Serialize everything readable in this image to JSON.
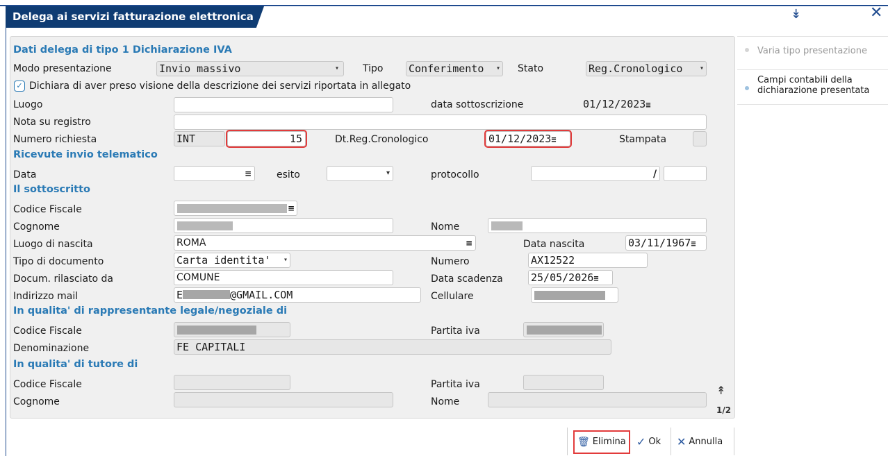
{
  "window": {
    "title": "Delega ai servizi fatturazione elettronica"
  },
  "sidebar": {
    "items": [
      {
        "label": "Varia tipo presentazione"
      },
      {
        "label_line1": "Campi contabili della",
        "label_line2": "dichiarazione presentata"
      }
    ]
  },
  "sections": {
    "dati_delega": "Dati delega di tipo 1 Dichiarazione IVA",
    "ricevute": "Ricevute invio telematico",
    "sottoscritto": "Il sottoscritto",
    "rappresentante": "In qualita' di rappresentante legale/negoziale  di",
    "tutore": "In qualita' di tutore di"
  },
  "form": {
    "modo_presentazione": {
      "label": "Modo presentazione",
      "value": "Invio massivo"
    },
    "tipo": {
      "label": "Tipo",
      "value": "Conferimento"
    },
    "stato": {
      "label": "Stato",
      "value": "Reg.Cronologico"
    },
    "dichiara": {
      "label": "Dichiara di aver preso visione della descrizione dei servizi riportata in allegato",
      "checked": true
    },
    "luogo": {
      "label": "Luogo",
      "value": ""
    },
    "data_sottoscrizione": {
      "label": "data sottoscrizione",
      "value": "01/12/2023"
    },
    "nota_registro": {
      "label": "Nota su registro",
      "value": ""
    },
    "numero_richiesta": {
      "label": "Numero richiesta",
      "prefix": "INT",
      "value": "15"
    },
    "dt_reg_cronologico": {
      "label": "Dt.Reg.Cronologico",
      "value": "01/12/2023"
    },
    "stampata": {
      "label": "Stampata"
    },
    "ricevute_data": {
      "label": "Data",
      "value": ""
    },
    "esito": {
      "label": "esito",
      "value": ""
    },
    "protocollo": {
      "label": "protocollo",
      "value": "",
      "separator": "/"
    },
    "sott_codice_fiscale": {
      "label": "Codice Fiscale"
    },
    "cognome": {
      "label": "Cognome"
    },
    "nome": {
      "label": "Nome"
    },
    "luogo_nascita": {
      "label": "Luogo di nascita",
      "value": "ROMA"
    },
    "data_nascita": {
      "label": "Data nascita",
      "value": "03/11/1967"
    },
    "tipo_documento": {
      "label": "Tipo di documento",
      "value": "Carta identita'"
    },
    "numero": {
      "label": "Numero",
      "value": "AX12522"
    },
    "rilasciato_da": {
      "label": "Docum. rilasciato da",
      "value": "COMUNE"
    },
    "data_scadenza": {
      "label": "Data scadenza",
      "value": "25/05/2026"
    },
    "indirizzo_mail": {
      "label": "Indirizzo mail",
      "prefix": "E",
      "suffix": "@GMAIL.COM"
    },
    "cellulare": {
      "label": "Cellulare"
    },
    "rapp_codice_fiscale": {
      "label": "Codice Fiscale"
    },
    "rapp_partita_iva": {
      "label": "Partita iva"
    },
    "denominazione": {
      "label": "Denominazione",
      "value": "FE CAPITALI"
    },
    "tut_codice_fiscale": {
      "label": "Codice Fiscale"
    },
    "tut_partita_iva": {
      "label": "Partita iva"
    },
    "tut_cognome": {
      "label": "Cognome"
    },
    "tut_nome": {
      "label": "Nome"
    }
  },
  "pager": {
    "label": "1/2"
  },
  "footer": {
    "elimina": "Elimina",
    "ok": "Ok",
    "annulla": "Annulla"
  },
  "icons": {
    "collapse": "double-chevron-down-icon",
    "close": "close-icon",
    "scroll_up": "double-chevron-up-icon",
    "calendar": "calendar-icon",
    "dropdown": "chevron-down-icon",
    "trash": "trash-icon",
    "check": "check-icon",
    "cancel": "x-icon"
  },
  "colors": {
    "title_bg": "#0f3c73",
    "section": "#2a7ab5",
    "highlight": "#e23b3b"
  }
}
